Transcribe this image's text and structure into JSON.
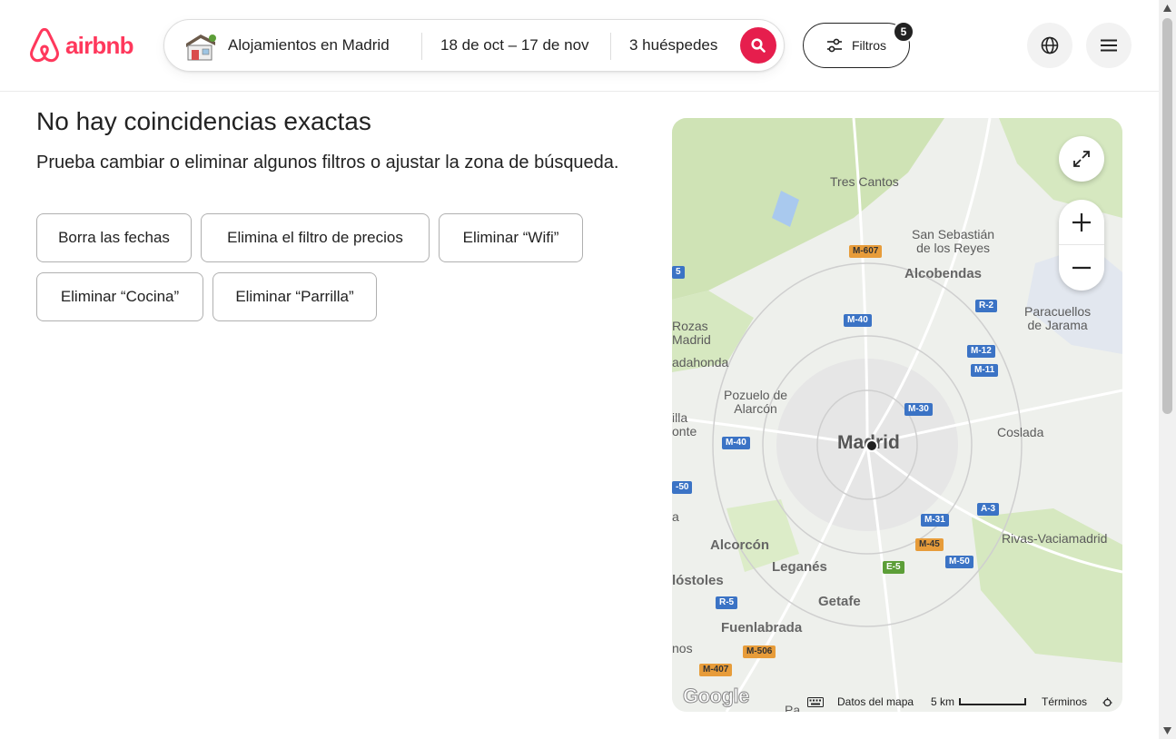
{
  "brand": {
    "name": "airbnb",
    "color": "#ff385c"
  },
  "search": {
    "location": "Alojamientos en Madrid",
    "dates": "18 de oct – 17 de nov",
    "guests": "3 huéspedes"
  },
  "filters": {
    "label": "Filtros",
    "count": "5"
  },
  "header_icons": [
    "globe-icon",
    "menu-icon"
  ],
  "results": {
    "title": "No hay coincidencias exactas",
    "subtitle": "Prueba cambiar o eliminar algunos filtros o ajustar la zona de búsqueda."
  },
  "chips": [
    "Borra las fechas",
    "Elimina el filtro de precios",
    "Eliminar “Wifi”",
    "Eliminar “Cocina”",
    "Eliminar “Parrilla”"
  ],
  "map": {
    "places": {
      "tres_cantos": "Tres Cantos",
      "san_sebastian": "San Sebastián\nde los Reyes",
      "alcobendas": "Alcobendas",
      "paracuellos": "Paracuellos\nde Jarama",
      "rozas": "Rozas\nMadrid",
      "majadahonda": "adahonda",
      "pozuelo": "Pozuelo de\nAlarcón",
      "villaviciosa": "illa\nonte",
      "madrid": "Madrid",
      "coslada": "Coslada",
      "alcorcon": "Alcorcón",
      "leganes": "Leganés",
      "rivas": "Rivas-Vaciamadrid",
      "mostoles": "lóstoles",
      "getafe": "Getafe",
      "fuenlabrada": "Fuenlabrada",
      "nos": "nos",
      "pa": "Pa",
      "a_left": "a"
    },
    "roads": {
      "m607": "M-607",
      "m40_n": "M-40",
      "r2": "R-2",
      "m12": "M-12",
      "m11": "M-11",
      "m30": "M-30",
      "m40_w": "M-40",
      "m50_w": "-50",
      "a3": "A-3",
      "m31": "M-31",
      "m45": "M-45",
      "e5": "E-5",
      "m50_e": "M-50",
      "r5": "R-5",
      "m506": "M-506",
      "m407": "M-407",
      "edge5": "5"
    },
    "footer": {
      "attribution": "Google",
      "data_label": "Datos del mapa",
      "scale": "5 km",
      "terms": "Términos"
    }
  }
}
